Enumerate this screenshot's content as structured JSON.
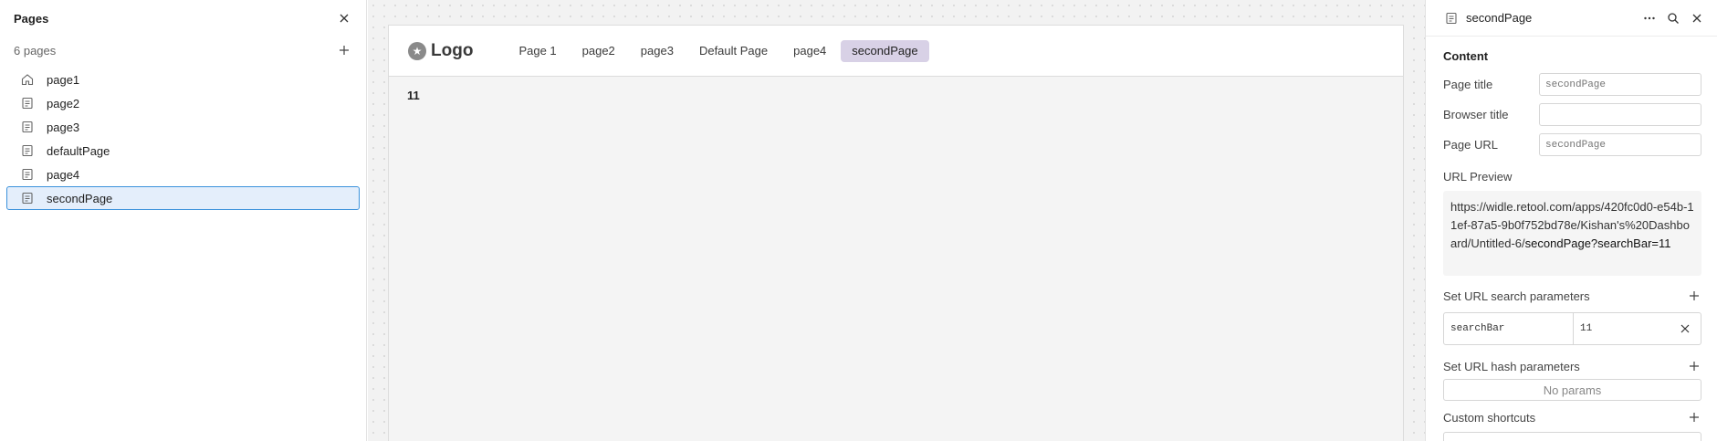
{
  "left_panel": {
    "title": "Pages",
    "count": "6 pages",
    "pages": [
      {
        "label": "page1",
        "icon": "home-icon"
      },
      {
        "label": "page2",
        "icon": "page-icon"
      },
      {
        "label": "page3",
        "icon": "page-icon"
      },
      {
        "label": "defaultPage",
        "icon": "page-icon"
      },
      {
        "label": "page4",
        "icon": "page-icon"
      },
      {
        "label": "secondPage",
        "icon": "page-icon",
        "selected": true
      }
    ]
  },
  "app": {
    "logo": "Logo",
    "nav": [
      "Page 1",
      "page2",
      "page3",
      "Default Page",
      "page4",
      "secondPage"
    ],
    "active_tab": "secondPage",
    "body_value": "11"
  },
  "right_panel": {
    "title": "secondPage",
    "content_section": "Content",
    "page_title_label": "Page title",
    "page_title_placeholder": "secondPage",
    "browser_title_label": "Browser title",
    "browser_title_value": "",
    "page_url_label": "Page URL",
    "page_url_placeholder": "secondPage",
    "url_preview_label": "URL Preview",
    "url_preview_base": "https://widle.retool.com/apps/420fc0d0-e54b-11ef-87a5-9b0f752bd78e/Kishan's%20Dashboard/Untitled-6/",
    "url_preview_path": "secondPage?searchBar=11",
    "search_params_label": "Set URL search parameters",
    "search_params": [
      {
        "key": "searchBar",
        "value": "11"
      }
    ],
    "hash_params_label": "Set URL hash parameters",
    "hash_params_empty": "No params",
    "custom_shortcuts_label": "Custom shortcuts"
  },
  "colors": {
    "selected_border": "#3c92dc",
    "selected_bg": "#e4eefb",
    "active_tab_bg": "#d8d1e6"
  }
}
